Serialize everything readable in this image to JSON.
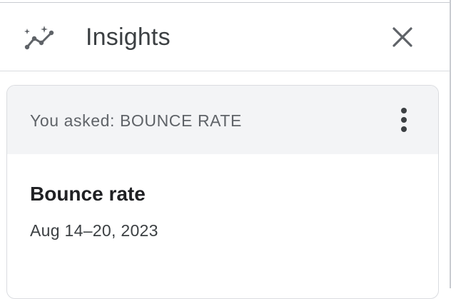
{
  "header": {
    "icon": "insights-sparkle-trend-icon",
    "title": "Insights",
    "close_icon": "close-icon"
  },
  "card": {
    "asked_label": "You asked: BOUNCE RATE",
    "more_icon": "more-vert-icon",
    "metric_title": "Bounce rate",
    "date_range": "Aug 14–20, 2023"
  },
  "colors": {
    "header_text": "#3c4043",
    "card_header_bg": "#f3f4f6",
    "border": "#dadce0",
    "icon": "#5f6368"
  }
}
